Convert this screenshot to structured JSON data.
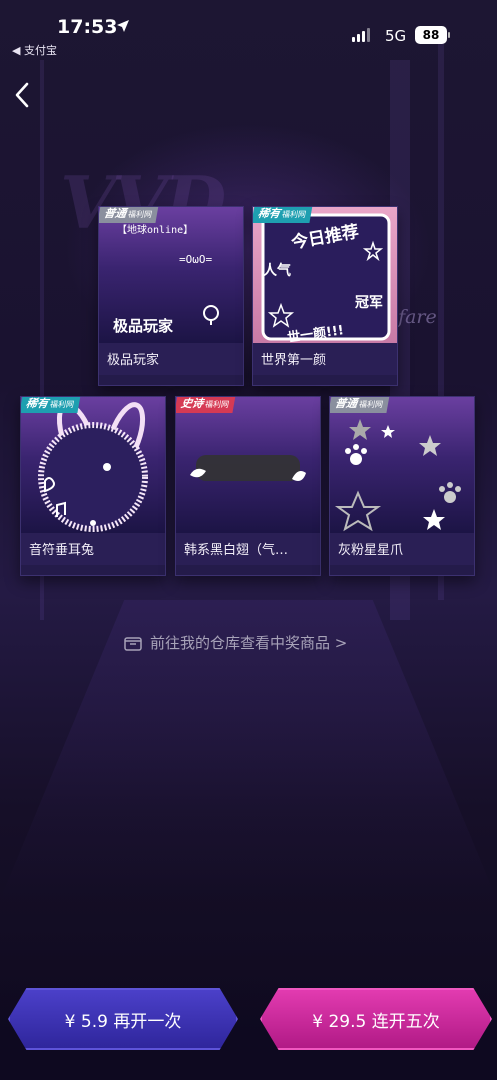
{
  "status_bar": {
    "time": "17:53",
    "back_app": "◀ 支付宝",
    "network": "5G",
    "battery": "88"
  },
  "decor": {
    "neon_script": "lfare"
  },
  "prizes": [
    {
      "name": "极品玩家",
      "rarity": "普通",
      "badge_sub": "福利网",
      "art_text_1": "【地球online】",
      "art_text_2": "=OωO=",
      "art_text_3": "极品玩家"
    },
    {
      "name": "世界第一颜",
      "rarity": "稀有",
      "badge_sub": "福利网",
      "art_text_1": "今日推荐",
      "art_text_2": "人气",
      "art_text_3": "冠军",
      "art_text_4": "世一颜!!!"
    },
    {
      "name": "音符垂耳兔",
      "rarity": "稀有",
      "badge_sub": "福利网"
    },
    {
      "name": "韩系黑白翅（气…",
      "rarity": "史诗",
      "badge_sub": "福利网"
    },
    {
      "name": "灰粉星星爪",
      "rarity": "普通",
      "badge_sub": "福利网"
    }
  ],
  "warehouse_link": "前往我的仓库查看中奖商品 >",
  "buttons": {
    "once": "¥ 5.9 再开一次",
    "five": "¥ 29.5 连开五次"
  },
  "colors": {
    "common_badge": "#8a8f9e",
    "rare_badge": "#1e9fb0",
    "epic_badge": "#d63a54",
    "btn_once": "#3f35b8",
    "btn_five": "#d42fa2"
  }
}
